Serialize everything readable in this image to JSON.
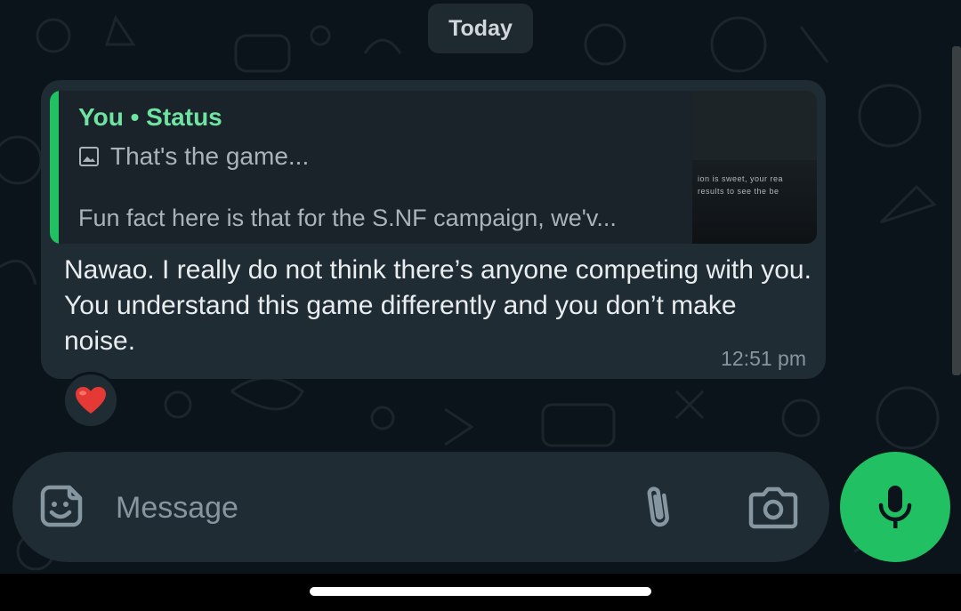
{
  "chat": {
    "date_divider": "Today",
    "message": {
      "quoted": {
        "author": "You • Status",
        "media_label": "That's the game...",
        "excerpt": "Fun fact here is that for the S.NF campaign, we'v...",
        "thumbnail_lines": [
          "ion is sweet, your rea",
          "results to see the be"
        ]
      },
      "text": "Nawao. I really do not think there’s anyone competing with you. You understand this game differently and you don’t make noise.",
      "time": "12:51 pm",
      "reaction": "❤️"
    }
  },
  "composer": {
    "placeholder": "Message",
    "value": ""
  },
  "colors": {
    "background": "#0b141a",
    "bubble": "#1f2c33",
    "accent_green": "#21c063",
    "quote_author": "#6ee3a2"
  },
  "icons": [
    "image-icon",
    "sticker-icon",
    "paperclip-icon",
    "camera-icon",
    "mic-icon"
  ]
}
